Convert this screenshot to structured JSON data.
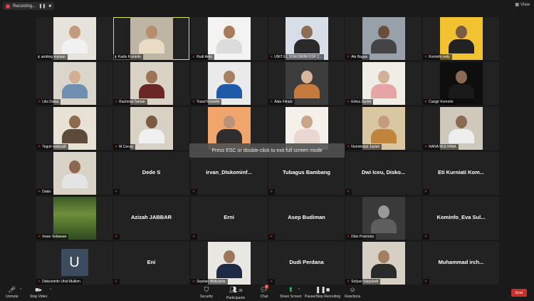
{
  "top_bar": {
    "recording_label": "Recording...",
    "view_label": "View"
  },
  "toast": "Press ESC or double-click to exit full screen mode",
  "participants": [
    {
      "name": "ambing m... ",
      "label": "ambing miyaan",
      "type": "video",
      "mic": "on",
      "skin": "#c39a7c",
      "shirt": "#f1f1f1",
      "bg": "#e6e2dc"
    },
    {
      "name": "Kadis Kominfo",
      "label": "Kadis Kominfo",
      "type": "video",
      "mic": "on",
      "skin": "#b88d6e",
      "shirt": "#e9dcc4",
      "bg": "#bfb5a5",
      "active": true
    },
    {
      "name": "Rudi Anto",
      "label": "Rudi Anto",
      "type": "video",
      "mic": "off",
      "skin": "#a97b5b",
      "shirt": "#dcdcdc",
      "bg": "#f3f3f1"
    },
    {
      "name": "UNIT E1 DISKOMINFOSP 2...",
      "label": "UNIT E1 DISKOMINFOSP 2...",
      "type": "video",
      "mic": "off",
      "skin": "#8c6e55",
      "shirt": "#2a2a2a",
      "bg": "#d8dee8"
    },
    {
      "name": "Ale Bagas",
      "label": "Ale Bagas",
      "type": "video",
      "mic": "off",
      "skin": "#6b4e3a",
      "shirt": "#444",
      "bg": "#98a0aa"
    },
    {
      "name": "Kominfo redy",
      "label": "Kominfo redy",
      "type": "video",
      "mic": "off",
      "skin": "#7a5a42",
      "shirt": "#222",
      "bg": "#f2c230"
    },
    {
      "name": "Lilis Dania",
      "label": "Lilis Dania",
      "type": "video",
      "mic": "off",
      "skin": "#d2ae92",
      "shirt": "#6e8fb0",
      "bg": "#dad6cc"
    },
    {
      "name": "Rachmat Taman",
      "label": "Rachmat Taman",
      "type": "video",
      "mic": "off",
      "skin": "#9c7559",
      "shirt": "#6b2626",
      "bg": "#d9d3c6"
    },
    {
      "name": "Yusuf Kominfo",
      "label": "Yusuf Kominfo",
      "type": "video",
      "mic": "off",
      "skin": "#a58063",
      "shirt": "#1e5aa8",
      "bg": "#eaeaea"
    },
    {
      "name": "Aida Fitriah",
      "label": "Aida Fitriah",
      "type": "video",
      "mic": "off",
      "skin": "#d8b69c",
      "shirt": "#c77a3e",
      "bg": "#3d3d3d"
    },
    {
      "name": "Erlina Zuchri",
      "label": "Erlina Zuchri",
      "type": "video",
      "mic": "off",
      "skin": "#d3b09a",
      "shirt": "#e6a4a4",
      "bg": "#f0ece6"
    },
    {
      "name": "Cangir Kominfo",
      "label": "Cangir Kominfo",
      "type": "video",
      "mic": "off",
      "skin": "#8a6a52",
      "shirt": "#1a1a1a",
      "bg": "#0e0e0e"
    },
    {
      "name": "Teguh wahyudi",
      "label": "Teguh wahyudi",
      "type": "video",
      "mic": "off",
      "skin": "#8e6a4e",
      "shirt": "#5d4a3a",
      "bg": "#e8e2d6"
    },
    {
      "name": "M Cecep",
      "label": "M Cecep",
      "type": "video",
      "mic": "off",
      "skin": "#7a5a42",
      "shirt": "#f0f0f0",
      "bg": "#d8d2c4"
    },
    {
      "name": "",
      "label": "",
      "type": "video",
      "mic": "off",
      "skin": "#b8937a",
      "shirt": "#2e2e2e",
      "bg": "#f0a56c"
    },
    {
      "name": "",
      "label": "",
      "type": "video",
      "mic": "off",
      "skin": "#c9a58a",
      "shirt": "#ead7d2",
      "bg": "#f5f0ea"
    },
    {
      "name": "Nurminatul Jaylah",
      "label": "Nurminatul Jaylah",
      "type": "video",
      "mic": "off",
      "skin": "#c69c7e",
      "shirt": "#c1843d",
      "bg": "#d9c7a4"
    },
    {
      "name": "NANA MULYANA",
      "label": "NANA MULYANA",
      "type": "video",
      "mic": "off",
      "skin": "#8a6a52",
      "shirt": "#eeeeee",
      "bg": "#cfc9bb"
    },
    {
      "name": "Dakis",
      "label": "Dakis",
      "type": "video",
      "mic": "off",
      "skin": "#8d6a4f",
      "shirt": "#e4e4e4",
      "bg": "#d9d3c7"
    },
    {
      "name": "Dede S",
      "label": "",
      "type": "name",
      "mic": "off"
    },
    {
      "name": "irvan_DIskominf...",
      "label": "",
      "type": "name",
      "mic": "off"
    },
    {
      "name": "Tubagus Bambang",
      "label": "",
      "type": "name",
      "mic": "off"
    },
    {
      "name": "Dwi Iceu, Disko...",
      "label": "",
      "type": "name",
      "mic": "off"
    },
    {
      "name": "Eti Kurniati Kom...",
      "label": "",
      "type": "name",
      "mic": "off"
    },
    {
      "name": "Irwan Setiawan",
      "label": "Irwan Setiawan",
      "type": "plants",
      "mic": "off"
    },
    {
      "name": "Azizah JABBAR",
      "label": "",
      "type": "name",
      "mic": "off"
    },
    {
      "name": "Erni",
      "label": "",
      "type": "name",
      "mic": "off"
    },
    {
      "name": "Asep Budiman",
      "label": "",
      "type": "name",
      "mic": "off"
    },
    {
      "name": "Dido Pramono",
      "label": "Dido Pramono",
      "type": "video",
      "mic": "off",
      "skin": "#9a9a9a",
      "shirt": "#5e5e5e",
      "bg": "#3a3a3a"
    },
    {
      "name": "Kominfo_Eva Sul...",
      "label": "",
      "type": "name",
      "mic": "off"
    },
    {
      "name": "Diskominfo Uhid Mulkim",
      "label": "Diskominfo Uhid Mulkim",
      "type": "avatar",
      "initial": "U",
      "mic": "off"
    },
    {
      "name": "Eni",
      "label": "",
      "type": "name",
      "mic": "off"
    },
    {
      "name": "Septian Widiyanto",
      "label": "Septian Widiyanto",
      "type": "video",
      "mic": "off",
      "skin": "#9c7659",
      "shirt": "#1f2a44",
      "bg": "#e9e7e2"
    },
    {
      "name": "Dudi Perdana",
      "label": "",
      "type": "name",
      "mic": "off"
    },
    {
      "name": "Sofyan Sopyandi",
      "label": "Sofyan Sopyandi",
      "type": "video",
      "mic": "off",
      "skin": "#a47e60",
      "shirt": "#2a2a2a",
      "bg": "#d6d0c4"
    },
    {
      "name": "Muhammad irch...",
      "label": "",
      "type": "name",
      "mic": "off"
    }
  ],
  "toolbar": {
    "unmute": "Unmute",
    "stop_video": "Stop Video",
    "security": "Security",
    "participants": "Participants",
    "participants_count": "36",
    "chat": "Chat",
    "chat_badge": "1",
    "share_screen": "Share Screen",
    "pause_recording": "Pause/Stop Recording",
    "reactions": "Reactions",
    "end": "End"
  },
  "colors": {
    "background": "#1a1a1a",
    "tile": "#222222",
    "active_border": "#d9e84d",
    "end_button": "#c8302b",
    "share_green": "#2ecc71",
    "muted_red": "#e0443a"
  }
}
